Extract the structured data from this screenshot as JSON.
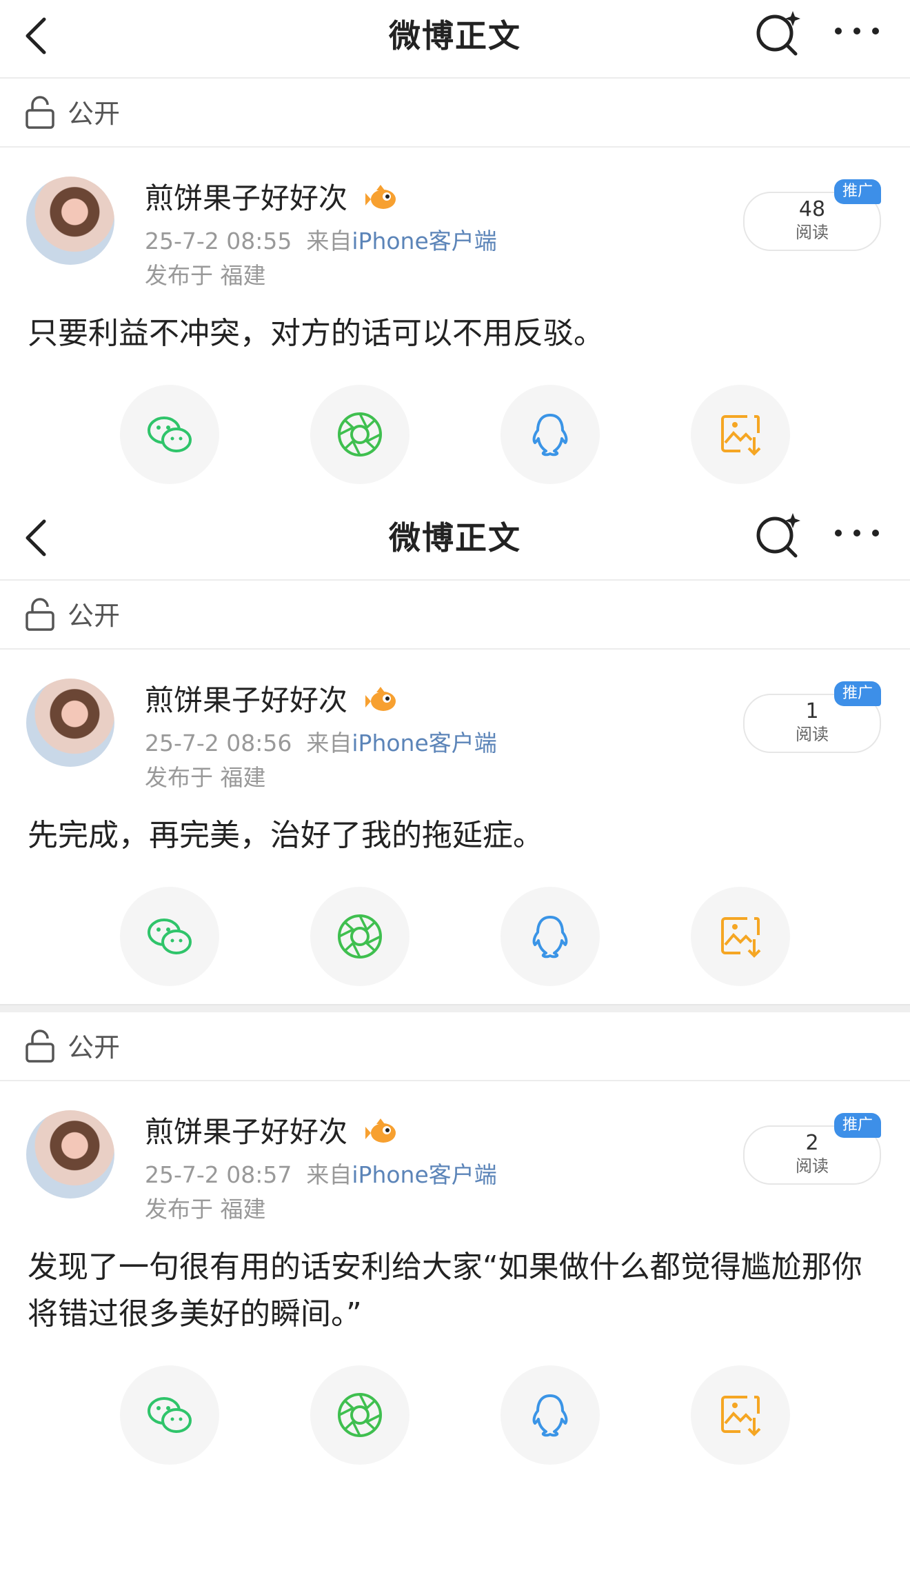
{
  "screens": [
    {
      "title": "微博正文",
      "visibility": "公开",
      "user": {
        "name": "煎饼果子好好次"
      },
      "meta": {
        "time": "25-7-2 08:55",
        "from": "来自",
        "source": "iPhone客户端",
        "location": "发布于 福建"
      },
      "reads": {
        "count": "48",
        "label": "阅读",
        "promo": "推广"
      },
      "text": "只要利益不冲突，对方的话可以不用反驳。"
    },
    {
      "title": "微博正文",
      "visibility": "公开",
      "user": {
        "name": "煎饼果子好好次"
      },
      "meta": {
        "time": "25-7-2 08:56",
        "from": "来自",
        "source": "iPhone客户端",
        "location": "发布于 福建"
      },
      "reads": {
        "count": "1",
        "label": "阅读",
        "promo": "推广"
      },
      "text": "先完成，再完美，治好了我的拖延症。"
    },
    {
      "visibility": "公开",
      "user": {
        "name": "煎饼果子好好次"
      },
      "meta": {
        "time": "25-7-2 08:57",
        "from": "来自",
        "source": "iPhone客户端",
        "location": "发布于 福建"
      },
      "reads": {
        "count": "2",
        "label": "阅读",
        "promo": "推广"
      },
      "text": "发现了一句很有用的话安利给大家“如果做什么都觉得尴尬那你将错过很多美好的瞬间。”"
    }
  ],
  "icons": {
    "back": "chevron-left-icon",
    "search": "search-sparkle-icon",
    "more": "more-dots-icon",
    "visibility": "unlock-icon",
    "badge": "fish-badge-icon",
    "share": [
      "wechat-icon",
      "moments-icon",
      "qq-icon",
      "save-image-icon"
    ]
  },
  "colors": {
    "source_link": "#5b84b8",
    "promo": "#3d8fe8",
    "wechat": "#2fc46a",
    "moments": "#3fbf4f",
    "qq": "#3a94e6",
    "save": "#f5a623"
  }
}
